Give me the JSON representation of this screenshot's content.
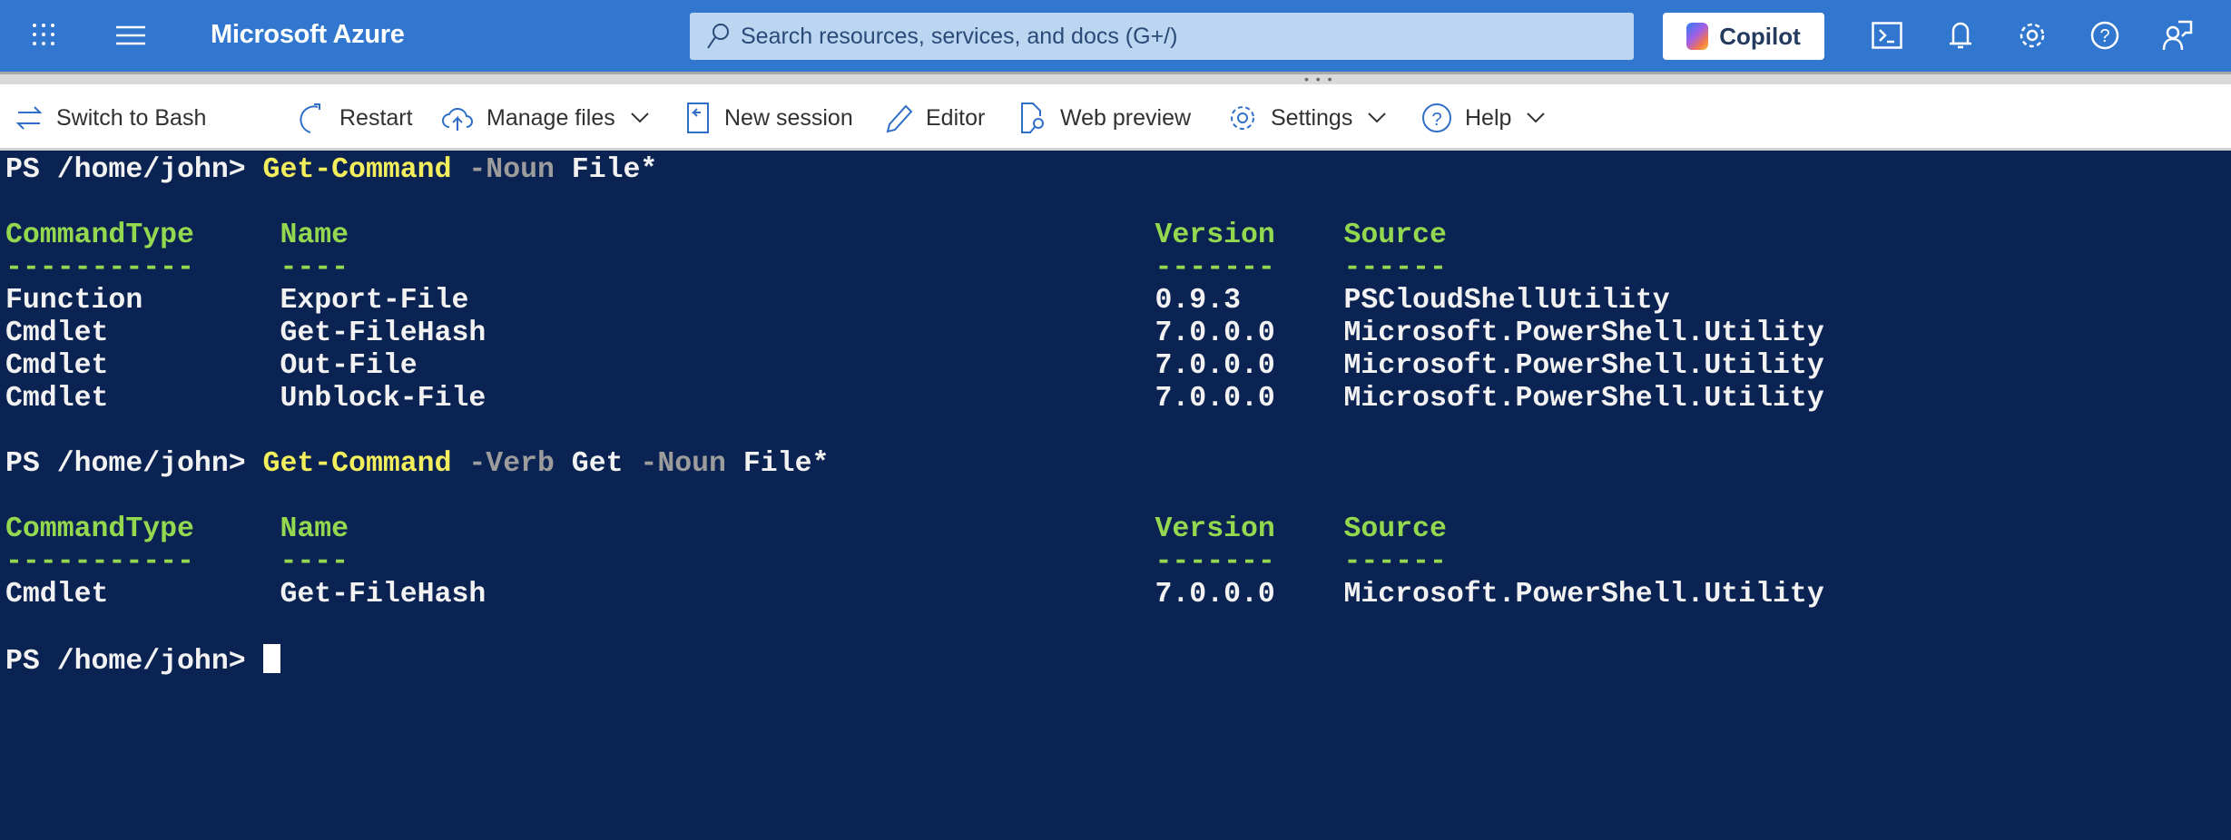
{
  "header": {
    "brand": "Microsoft Azure",
    "search_placeholder": "Search resources, services, and docs (G+/)",
    "copilot_label": "Copilot",
    "icons": [
      "app-launcher-icon",
      "hamburger-menu-icon",
      "cloud-shell-icon",
      "bell-icon",
      "gear-icon",
      "help-icon",
      "feedback-icon"
    ]
  },
  "toolbar": {
    "switch": "Switch to Bash",
    "restart": "Restart",
    "manage_files": "Manage files",
    "new_session": "New session",
    "editor": "Editor",
    "web_preview": "Web preview",
    "settings": "Settings",
    "help": "Help"
  },
  "colors": {
    "accent": "#3277cf",
    "terminal_bg": "#0b2352",
    "command": "#f3ee5c",
    "header": "#93d84f",
    "param": "#9c9c9c"
  },
  "terminal": {
    "lines": [
      [
        {
          "c": "w",
          "t": "PS /home/john> "
        },
        {
          "c": "y",
          "t": "Get-Command"
        },
        {
          "c": "p",
          "t": " -Noun"
        },
        {
          "c": "w",
          "t": " File*"
        }
      ],
      [],
      [
        {
          "c": "g",
          "t": "CommandType     Name                                               Version    Source"
        }
      ],
      [
        {
          "c": "g",
          "t": "-----------     ----                                               -------    ------"
        }
      ],
      [
        {
          "c": "w",
          "t": "Function        Export-File                                        0.9.3      PSCloudShellUtility"
        }
      ],
      [
        {
          "c": "w",
          "t": "Cmdlet          Get-FileHash                                       7.0.0.0    Microsoft.PowerShell.Utility"
        }
      ],
      [
        {
          "c": "w",
          "t": "Cmdlet          Out-File                                           7.0.0.0    Microsoft.PowerShell.Utility"
        }
      ],
      [
        {
          "c": "w",
          "t": "Cmdlet          Unblock-File                                       7.0.0.0    Microsoft.PowerShell.Utility"
        }
      ],
      [],
      [
        {
          "c": "w",
          "t": "PS /home/john> "
        },
        {
          "c": "y",
          "t": "Get-Command"
        },
        {
          "c": "p",
          "t": " -Verb"
        },
        {
          "c": "w",
          "t": " Get"
        },
        {
          "c": "p",
          "t": " -Noun"
        },
        {
          "c": "w",
          "t": " File*"
        }
      ],
      [],
      [
        {
          "c": "g",
          "t": "CommandType     Name                                               Version    Source"
        }
      ],
      [
        {
          "c": "g",
          "t": "-----------     ----                                               -------    ------"
        }
      ],
      [
        {
          "c": "w",
          "t": "Cmdlet          Get-FileHash                                       7.0.0.0    Microsoft.PowerShell.Utility"
        }
      ],
      [],
      [
        {
          "c": "w",
          "t": "PS /home/john> "
        },
        {
          "c": "cursor",
          "t": ""
        }
      ]
    ]
  }
}
